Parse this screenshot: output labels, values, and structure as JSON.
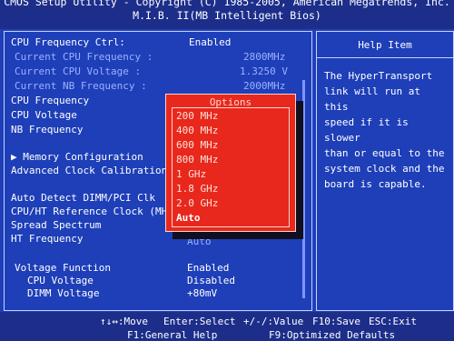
{
  "header": {
    "line1": "CMOS Setup Utility - Copyright (C) 1985-2005, American Megatrends, Inc.",
    "line2": "M.I.B. II(MB Intelligent Bios)"
  },
  "left": {
    "cpu_freq_ctrl_label": "CPU Frequency Ctrl:",
    "cpu_freq_ctrl_value": "Enabled",
    "current_cpu_freq_label": "Current CPU Frequency :",
    "current_cpu_freq_value": "2800MHz",
    "current_cpu_voltage_label": "Current CPU Voltage  :",
    "current_cpu_voltage_value": "1.3250 V",
    "current_nb_freq_label": "Current NB Frequency  :",
    "current_nb_freq_value": "2000MHz",
    "cpu_frequency_label": "CPU Frequency",
    "cpu_voltage_label": "CPU Voltage",
    "nb_frequency_label": "NB Frequency",
    "memory_config_label": "Memory Configuration",
    "memory_config_arrow": "▶",
    "adv_clock_cal_label": "Advanced Clock Calibration",
    "auto_detect_label": "Auto Detect DIMM/PCI Clk",
    "cpu_ht_ref_label": "CPU/HT Reference Clock (MH",
    "spread_spectrum_label": "Spread Spectrum",
    "ht_frequency_label": "HT Frequency",
    "ht_frequency_value": "Auto",
    "voltage_function_label": "Voltage Function",
    "voltage_function_value": "Enabled",
    "cpu_voltage2_label": "CPU  Voltage",
    "cpu_voltage2_value": "Disabled",
    "dimm_voltage_label": "DIMM Voltage",
    "dimm_voltage_value": "+80mV"
  },
  "popup": {
    "title": "Options",
    "options": [
      "200 MHz",
      "400 MHz",
      "600 MHz",
      "800 MHz",
      "1 GHz",
      "1.8 GHz",
      "2.0 GHz",
      "Auto"
    ]
  },
  "help": {
    "title": "Help Item",
    "text": "The HyperTransport\nlink will run at this\nspeed if it is slower\nthan or equal to the\nsystem clock and the\nboard is capable."
  },
  "footer": {
    "move": "↑↓↔:Move",
    "select": "Enter:Select",
    "value": "+/-/:Value",
    "save": "F10:Save",
    "exit": "ESC:Exit",
    "general_help": "F1:General Help",
    "optimized": "F9:Optimized Defaults"
  }
}
